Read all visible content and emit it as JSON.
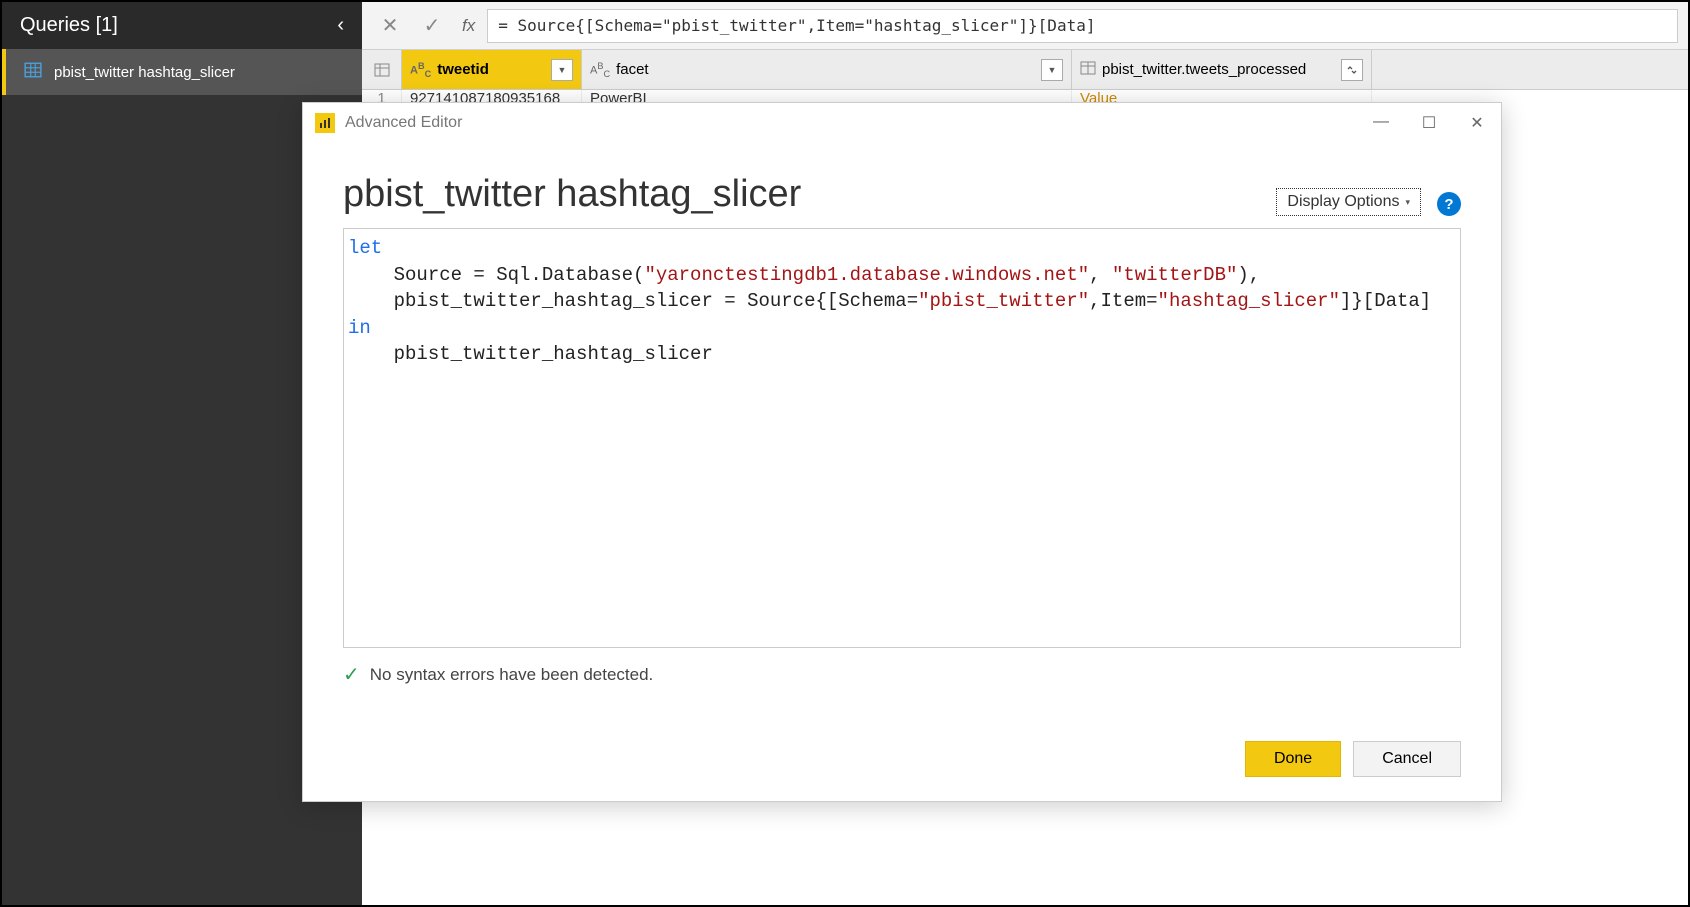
{
  "sidebar": {
    "title": "Queries [1]",
    "items": [
      {
        "label": "pbist_twitter hashtag_slicer"
      }
    ]
  },
  "formula_bar": {
    "text": "= Source{[Schema=\"pbist_twitter\",Item=\"hashtag_slicer\"]}[Data]"
  },
  "grid": {
    "columns": [
      {
        "name": "tweetid",
        "type": "ABC"
      },
      {
        "name": "facet",
        "type": "ABC"
      },
      {
        "name": "pbist_twitter.tweets_processed",
        "type": "table"
      }
    ],
    "rows": [
      {
        "num": "1",
        "tweetid": "927141087180935168",
        "facet": "PowerBI",
        "link": "Value"
      }
    ]
  },
  "dialog": {
    "titlebar": "Advanced Editor",
    "title": "pbist_twitter hashtag_slicer",
    "display_options": "Display Options",
    "code": {
      "line1_kw": "let",
      "line2_a": "    Source = Sql.Database(",
      "line2_s1": "\"yaronctestingdb1.database.windows.net\"",
      "line2_b": ", ",
      "line2_s2": "\"twitterDB\"",
      "line2_c": "),",
      "line3_a": "    pbist_twitter_hashtag_slicer = Source{[Schema=",
      "line3_s1": "\"pbist_twitter\"",
      "line3_b": ",Item=",
      "line3_s2": "\"hashtag_slicer\"",
      "line3_c": "]}[Data]",
      "line4_kw": "in",
      "line5": "    pbist_twitter_hashtag_slicer"
    },
    "status": "No syntax errors have been detected.",
    "done": "Done",
    "cancel": "Cancel"
  }
}
